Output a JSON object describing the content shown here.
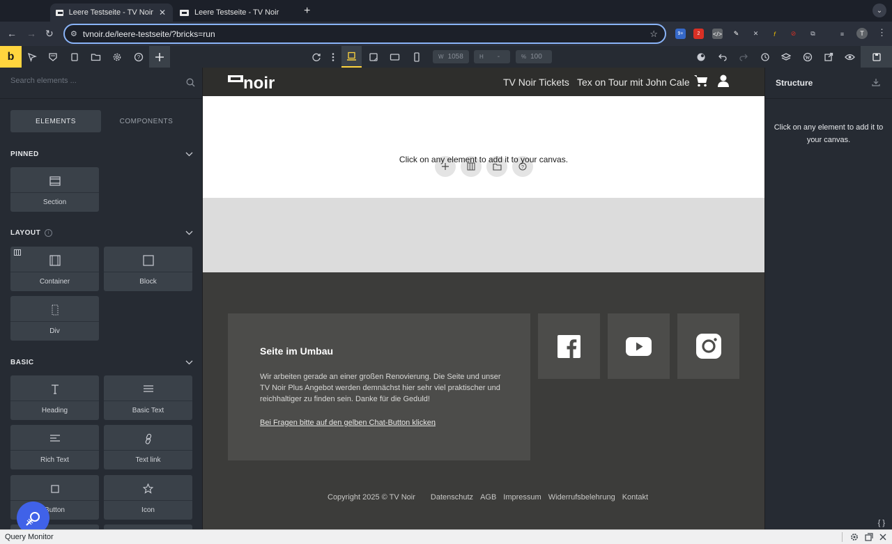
{
  "browser": {
    "tabs": [
      {
        "title": "Leere Testseite - TV Noir",
        "active": true
      },
      {
        "title": "Leere Testseite - TV Noir",
        "active": false
      }
    ],
    "new_tab": "+",
    "url": "tvnoir.de/leere-testseite/?bricks=run",
    "profile_initial": "T",
    "ext_badges": [
      "9+",
      "2"
    ]
  },
  "toolbar": {
    "logo": "b",
    "width_label": "W",
    "width_value": "1058",
    "height_label": "H",
    "height_value": "-",
    "scale_label": "%",
    "scale_value": "100"
  },
  "left_panel": {
    "search_placeholder": "Search elements ...",
    "tabs": {
      "elements": "ELEMENTS",
      "components": "COMPONENTS"
    },
    "sections": {
      "pinned": {
        "title": "PINNED",
        "items": [
          "Section"
        ]
      },
      "layout": {
        "title": "LAYOUT",
        "items": [
          "Container",
          "Block",
          "Div"
        ]
      },
      "basic": {
        "title": "BASIC",
        "items": [
          "Heading",
          "Basic Text",
          "Rich Text",
          "Text link",
          "Button",
          "Icon"
        ]
      }
    }
  },
  "canvas": {
    "logo_text": "noir",
    "nav": [
      "TV Noir Tickets",
      "Tex on Tour mit John Cale"
    ],
    "empty_message": "Click on any element to add it to your canvas.",
    "footer": {
      "title": "Seite im Umbau",
      "text": "Wir arbeiten gerade an einer großen Renovierung. Die Seite und unser TV Noir Plus Angebot werden demnächst hier sehr viel praktischer und reichhaltiger zu finden sein. Danke für die Geduld!",
      "link": "Bei Fragen bitte auf den gelben Chat-Button klicken",
      "link_arrow": "↓",
      "copyright": "Copyright 2025 © TV Noir",
      "legal_links": [
        "Datenschutz",
        "AGB",
        "Impressum",
        "Widerrufsbelehrung",
        "Kontakt"
      ]
    }
  },
  "right_panel": {
    "title": "Structure",
    "message": "Click on any element to add it to your canvas."
  },
  "query_monitor": {
    "label": "Query Monitor"
  },
  "colors": {
    "accent": "#ffd53e",
    "panel": "#262b33",
    "card": "#3a4149",
    "fab": "#4062e8"
  }
}
